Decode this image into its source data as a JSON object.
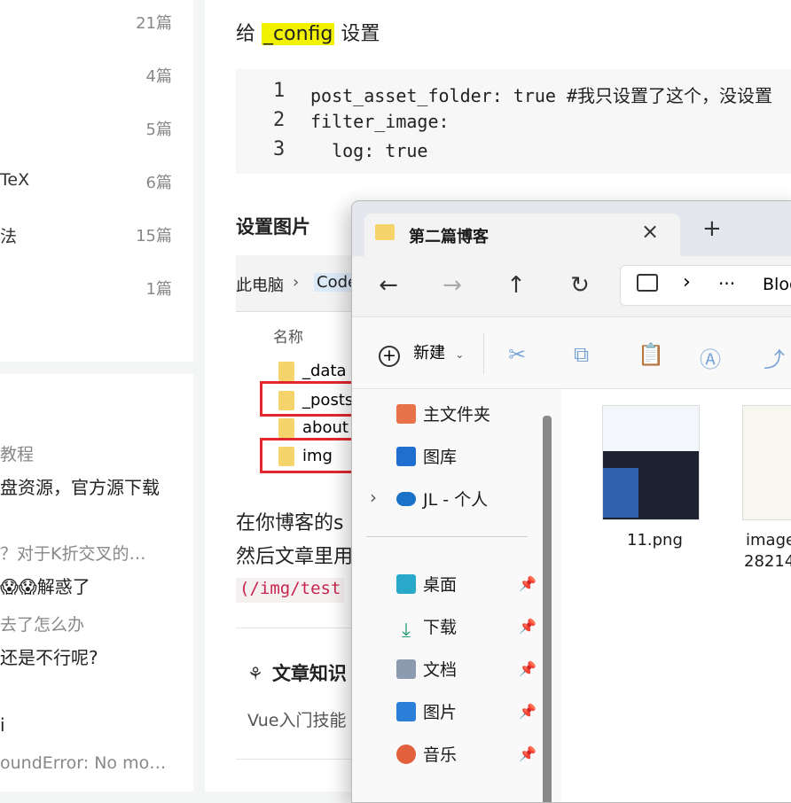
{
  "sidebar": {
    "categories": [
      {
        "name": "",
        "count": "21篇"
      },
      {
        "name": "",
        "count": "4篇"
      },
      {
        "name": "",
        "count": "5篇"
      },
      {
        "name": "TeX",
        "count": "6篇"
      },
      {
        "name": "法",
        "count": "15篇"
      },
      {
        "name": "",
        "count": "1篇"
      }
    ],
    "comments": [
      {
        "title": "教程",
        "body": "盘资源，官方源下载"
      },
      {
        "title": "？对于K折交叉的…",
        "body": "😱😱解惑了"
      },
      {
        "title": "去了怎么办",
        "body": "还是不行呢?"
      },
      {
        "title": "",
        "body": "i"
      },
      {
        "title": "oundError: No mo…",
        "body": ""
      }
    ]
  },
  "article": {
    "config_prefix": "给",
    "config_highlight": "_config",
    "config_suffix": "设置",
    "code_lines": [
      {
        "num": "1",
        "text": "post_asset_folder: true #我只设置了这个，没设置"
      },
      {
        "num": "2",
        "text": "filter_image:"
      },
      {
        "num": "3",
        "text": "  log: true"
      }
    ],
    "set_image_heading": "设置图片",
    "embedded": {
      "crumb_pc": "此电脑",
      "crumb_sep": "›",
      "crumb_code": "Code",
      "col_name": "名称",
      "folders": [
        "_data",
        "_posts",
        "about",
        "img"
      ]
    },
    "para1": "在你博客的s",
    "para2": "然后文章里用",
    "inline_code": "(/img/test",
    "knowledge_heading": "文章知识",
    "knowledge_text": "Vue入门技能"
  },
  "explorer": {
    "tab_title": "第二篇博客",
    "close_glyph": "×",
    "new_tab_glyph": "+",
    "address_more": "···",
    "address_text": "Blog",
    "new_label": "新建",
    "nav": [
      {
        "label": "主文件夹",
        "icon": "home-icon",
        "pinned": false
      },
      {
        "label": "图库",
        "icon": "gallery-icon",
        "pinned": false
      },
      {
        "label": "JL - 个人",
        "icon": "onedrive-icon",
        "pinned": false
      },
      {
        "label": "桌面",
        "icon": "desktop-icon",
        "pinned": true
      },
      {
        "label": "下载",
        "icon": "download-icon",
        "pinned": true
      },
      {
        "label": "文档",
        "icon": "documents-icon",
        "pinned": true
      },
      {
        "label": "图片",
        "icon": "pictures-icon",
        "pinned": true
      },
      {
        "label": "音乐",
        "icon": "music-icon",
        "pinned": true
      }
    ],
    "files": [
      {
        "name": "11.png"
      },
      {
        "name": "image",
        "name2": "28214"
      }
    ]
  },
  "colors": {
    "highlight": "#f2f200",
    "accent": "#0067c0",
    "red_box": "#e0282e",
    "inline_code_fg": "#c7254e"
  }
}
